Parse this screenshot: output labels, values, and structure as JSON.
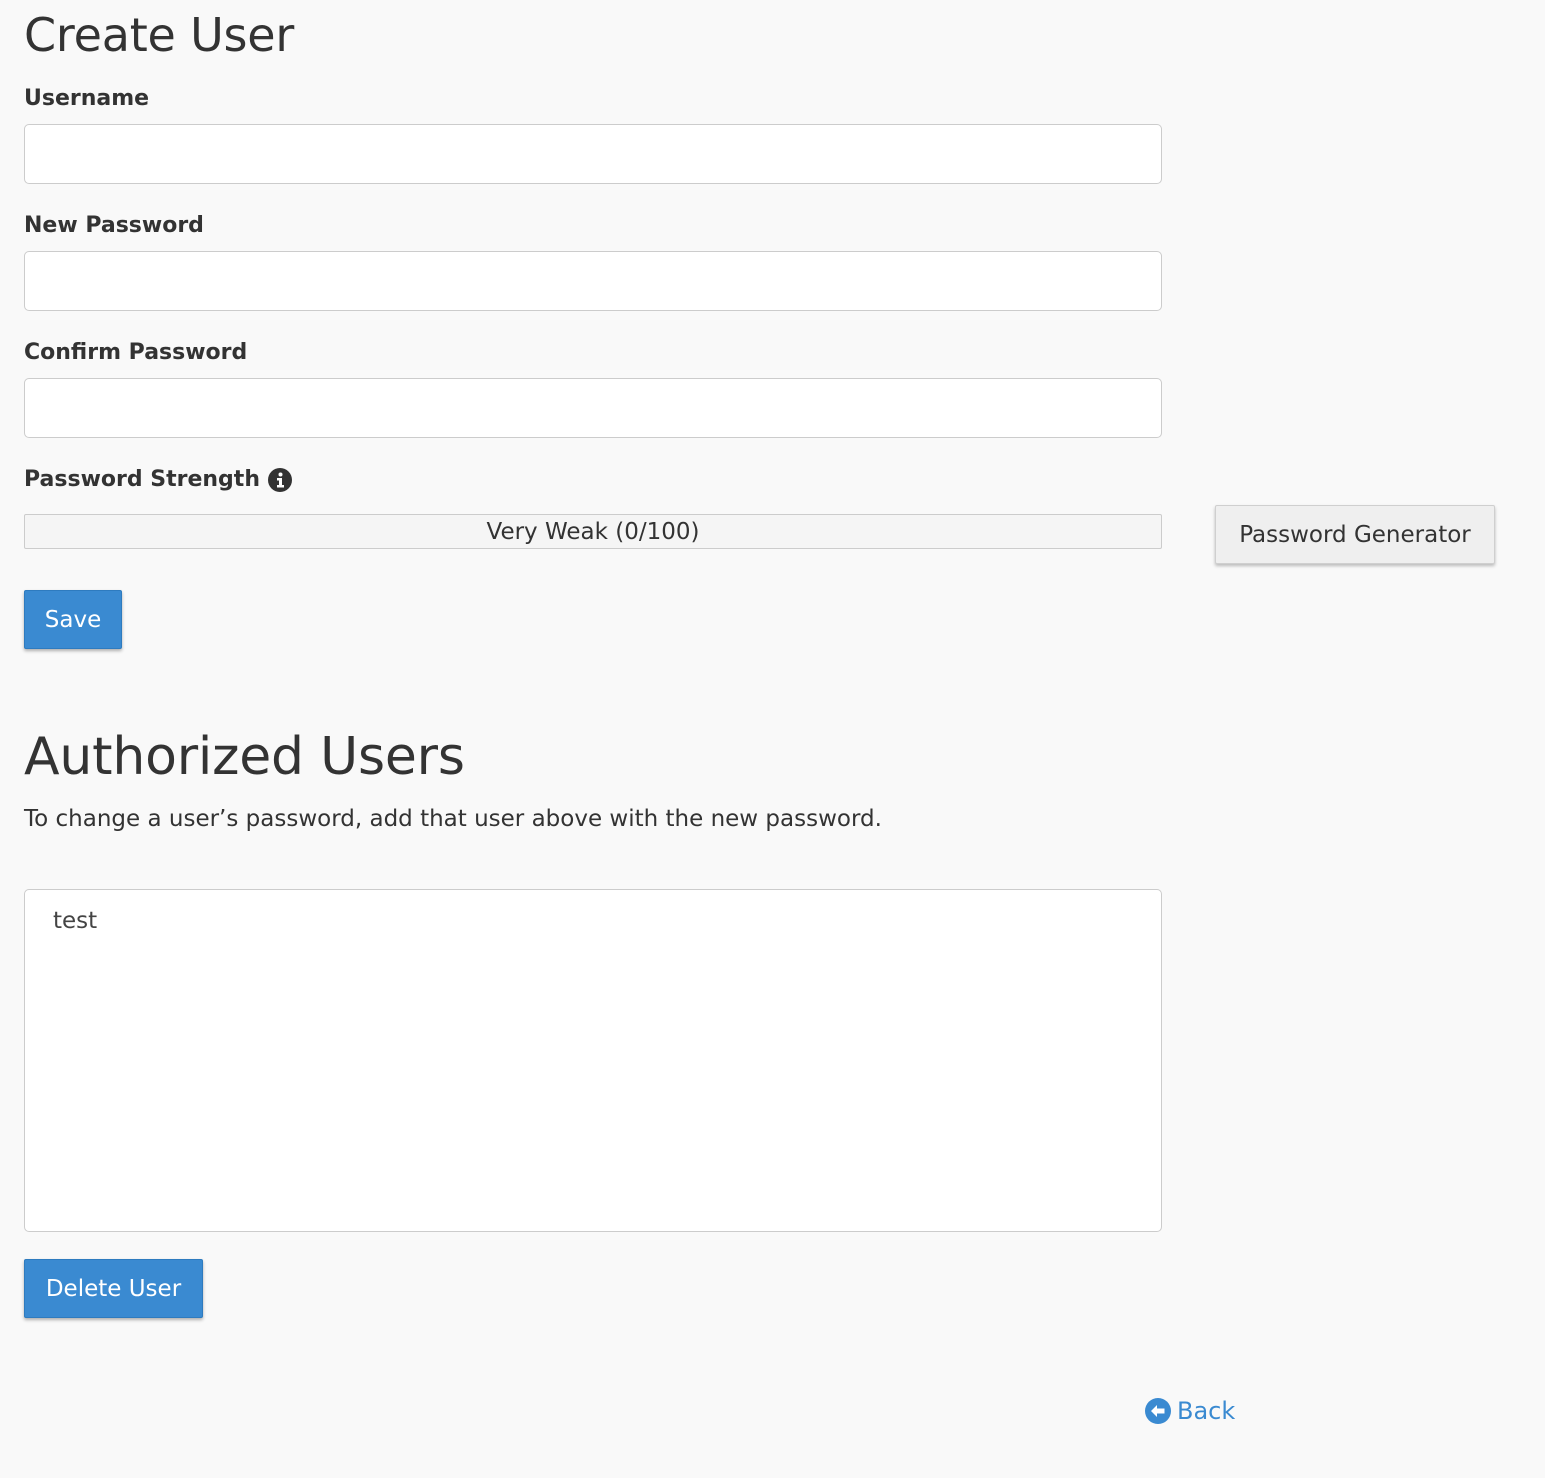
{
  "create_user": {
    "title": "Create User",
    "username_label": "Username",
    "username_value": "",
    "new_password_label": "New Password",
    "new_password_value": "",
    "confirm_password_label": "Confirm Password",
    "confirm_password_value": "",
    "strength_label": "Password Strength",
    "strength_text": "Very Weak (0/100)",
    "strength_value": 0,
    "strength_max": 100,
    "generator_button": "Password Generator",
    "save_button": "Save"
  },
  "authorized_users": {
    "title": "Authorized Users",
    "description": "To change a user’s password, add that user above with the new password.",
    "users": [
      "test"
    ],
    "delete_button": "Delete User"
  },
  "footer": {
    "back_link": "Back"
  },
  "icons": {
    "info": "info-icon",
    "back": "arrow-circle-left-icon"
  },
  "colors": {
    "primary": "#3a8ad1",
    "text": "#333333",
    "background": "#f9f9f9"
  }
}
